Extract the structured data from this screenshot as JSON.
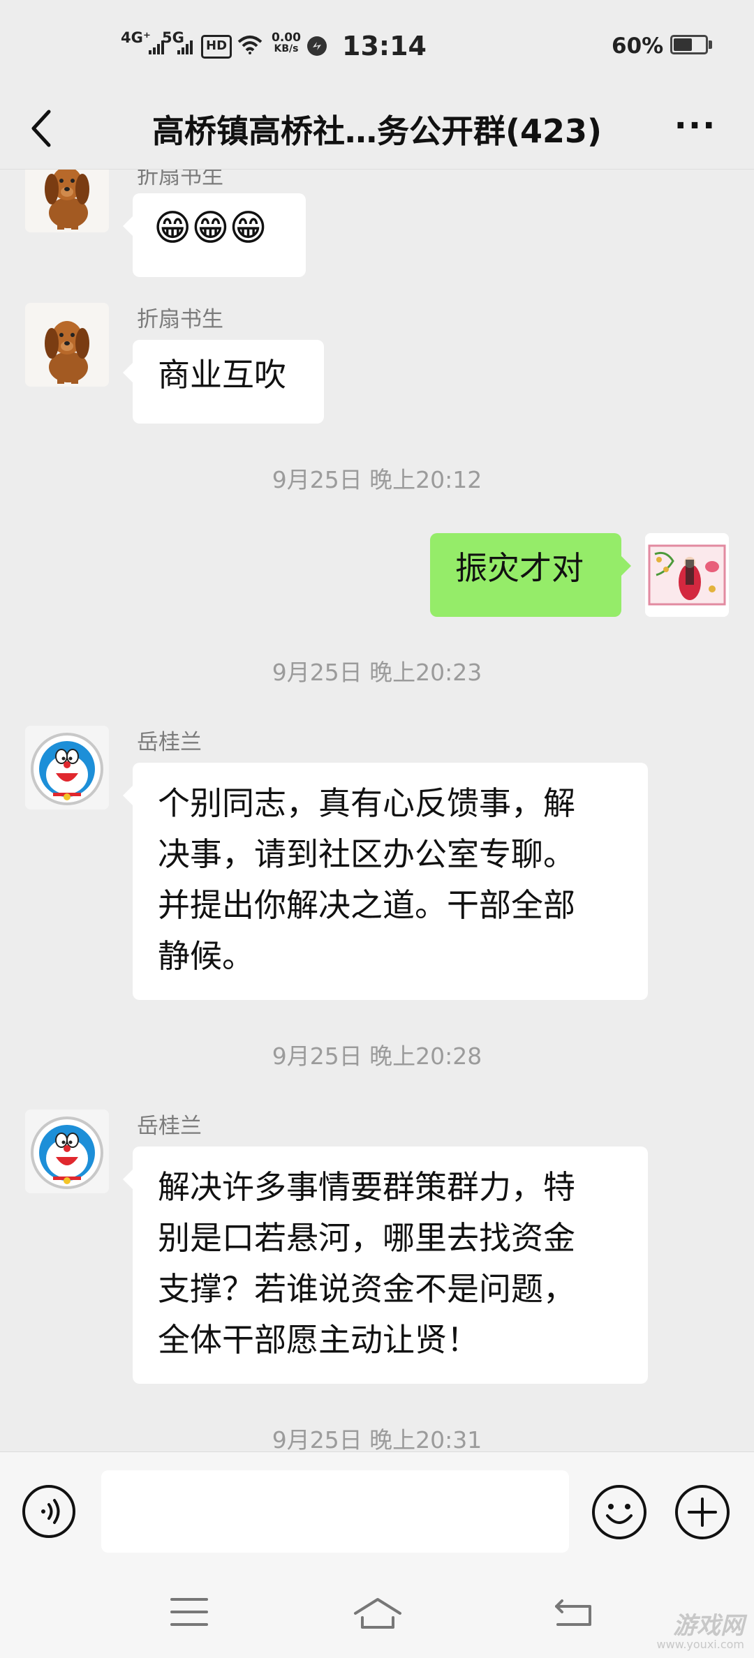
{
  "status_bar": {
    "net1": "4G⁺",
    "net2": "5G",
    "hd": "HD",
    "speed_value": "0.00",
    "speed_unit": "KB/s",
    "time": "13:14",
    "battery": "60%",
    "battery_level": 0.6
  },
  "header": {
    "title": "高桥镇高桥社…务公开群(423)"
  },
  "messages": [
    {
      "sender": "折扇书生",
      "text": "😁😁😁",
      "avatar": "puppy-avatar"
    },
    {
      "sender": "折扇书生",
      "text": "商业互吹",
      "avatar": "puppy-avatar"
    },
    {
      "time": "9月25日 晚上20:12"
    },
    {
      "text": "振灾才对",
      "mine": true,
      "avatar": "wedding-picture-avatar"
    },
    {
      "time": "9月25日 晚上20:23"
    },
    {
      "sender": "岳桂兰",
      "lines": [
        "个别同志，真有心反馈事，解",
        "决事，请到社区办公室专聊。",
        "并提出你解决之道。干部全部",
        "静候。"
      ],
      "avatar": "doraemon-avatar"
    },
    {
      "time": "9月25日 晚上20:28"
    },
    {
      "sender": "岳桂兰",
      "lines": [
        "解决许多事情要群策群力，特",
        "别是口若悬河，哪里去找资金",
        "支撑？若谁说资金不是问题，",
        "全体干部愿主动让贤！"
      ],
      "avatar": "doraemon-avatar"
    },
    {
      "time": "9月25日 晚上20:31"
    }
  ],
  "input": {
    "placeholder": ""
  },
  "watermark": {
    "line1": "游戏网",
    "line2": "www.youxi.com"
  },
  "icons": [
    "back-arrow-icon",
    "more-dots-icon",
    "voice-icon",
    "emoji-icon",
    "plus-icon",
    "menu-icon",
    "home-icon",
    "back-icon",
    "wifi-icon",
    "signal-icon"
  ]
}
